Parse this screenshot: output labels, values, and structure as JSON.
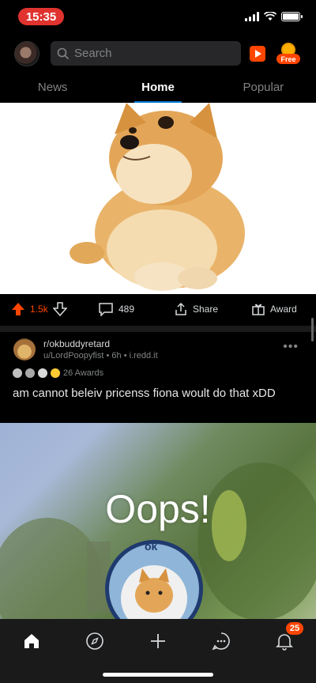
{
  "status_bar": {
    "time": "15:35"
  },
  "header": {
    "search_placeholder": "Search",
    "free_badge": "Free"
  },
  "tabs": [
    {
      "label": "News"
    },
    {
      "label": "Home"
    },
    {
      "label": "Popular"
    }
  ],
  "post1_actions": {
    "upvotes": "1.5k",
    "comments": "489",
    "share": "Share",
    "award": "Award"
  },
  "post2": {
    "subreddit": "r/okbuddyretard",
    "meta": "u/LordPoopyfist • 6h • i.redd.it",
    "awards": "26 Awards",
    "title": "am cannot beleiv pricenss fiona woult do that xDD",
    "image_text": "Oops!",
    "image_badge_text": "ok"
  },
  "bottom_nav": {
    "notification_count": "25"
  },
  "colors": {
    "accent": "#ff4500",
    "status_time_bg": "#e0332f",
    "tab_underline": "#0079d3",
    "background": "#000000"
  }
}
